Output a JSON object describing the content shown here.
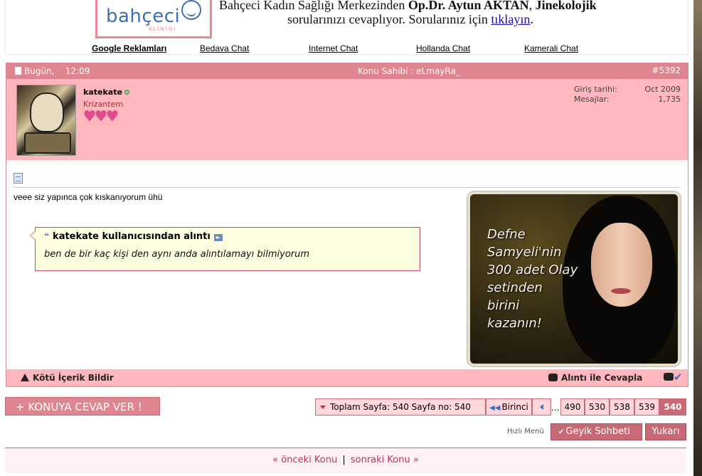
{
  "header": {
    "logo_text": "bahçeci",
    "logo_sub": "KLİNİĞİ",
    "line1_prefix": "Bahçeci Kadın Sağlığı Merkezinden ",
    "line1_doctor": "Op.Dr. Aytun AKTAN",
    "line1_comma": ", ",
    "line1_spec": "Jinekolojik",
    "line2_prefix": "sorularınızı cevaplıyor. Sorularınız için ",
    "line2_link": "tıklayın",
    "line2_suffix": ".",
    "ad_links": [
      "Google Reklamları",
      "Bedava Chat",
      "Internet Chat",
      "Hollanda Chat",
      "Kamerali Chat"
    ]
  },
  "post": {
    "date": "Bugün,",
    "time": "12:09",
    "owner": "Konu Sahibi : eLmayRa_",
    "number": "#5392",
    "user": {
      "name": "katekate",
      "title": "Krizantem",
      "hearts": [
        "♥",
        "♥",
        "♥"
      ],
      "join_label": "Giriş tarihi:",
      "join_value": "Oct 2009",
      "posts_label": "Mesajlar:",
      "posts_value": "1,735"
    },
    "text": "veee siz yapınca çok kıskanıyorum ühü",
    "quote": {
      "author": "katekate kullanıcısından alıntı",
      "text": "ben de bir kaç kişi den aynı anda alıntılamayı bilmiyorum"
    },
    "ad_lines": [
      "Defne",
      "Samyeli'nin",
      "300 adet Olay",
      "setinden",
      "birini",
      "kazanın!"
    ],
    "footer": {
      "report": "Kötü İçerik Bildir",
      "quote_reply": "Alıntı ile Cevapla"
    }
  },
  "reply_button": "+ KONUYA CEVAP VER !",
  "pagination": {
    "summary": "Toplam Sayfa: 540 Sayfa no: 540",
    "first": "Birinci",
    "dots": "...",
    "pages": [
      "490",
      "530",
      "538",
      "539",
      "540"
    ],
    "current": "540"
  },
  "quick_menu": {
    "label": "Hızlı Menü",
    "selected": "Geyik Sohbeti",
    "top": "Yukarı"
  },
  "thread_nav": {
    "prev": "« önceki Konu",
    "separator": "|",
    "next": "sonraki Konu »"
  },
  "colors": {
    "accent": "#e0848f",
    "user_bar": "#ffb7bd",
    "quote_border": "#c0506b",
    "quote_bg": "#fffde0",
    "link": "#c0304a"
  }
}
